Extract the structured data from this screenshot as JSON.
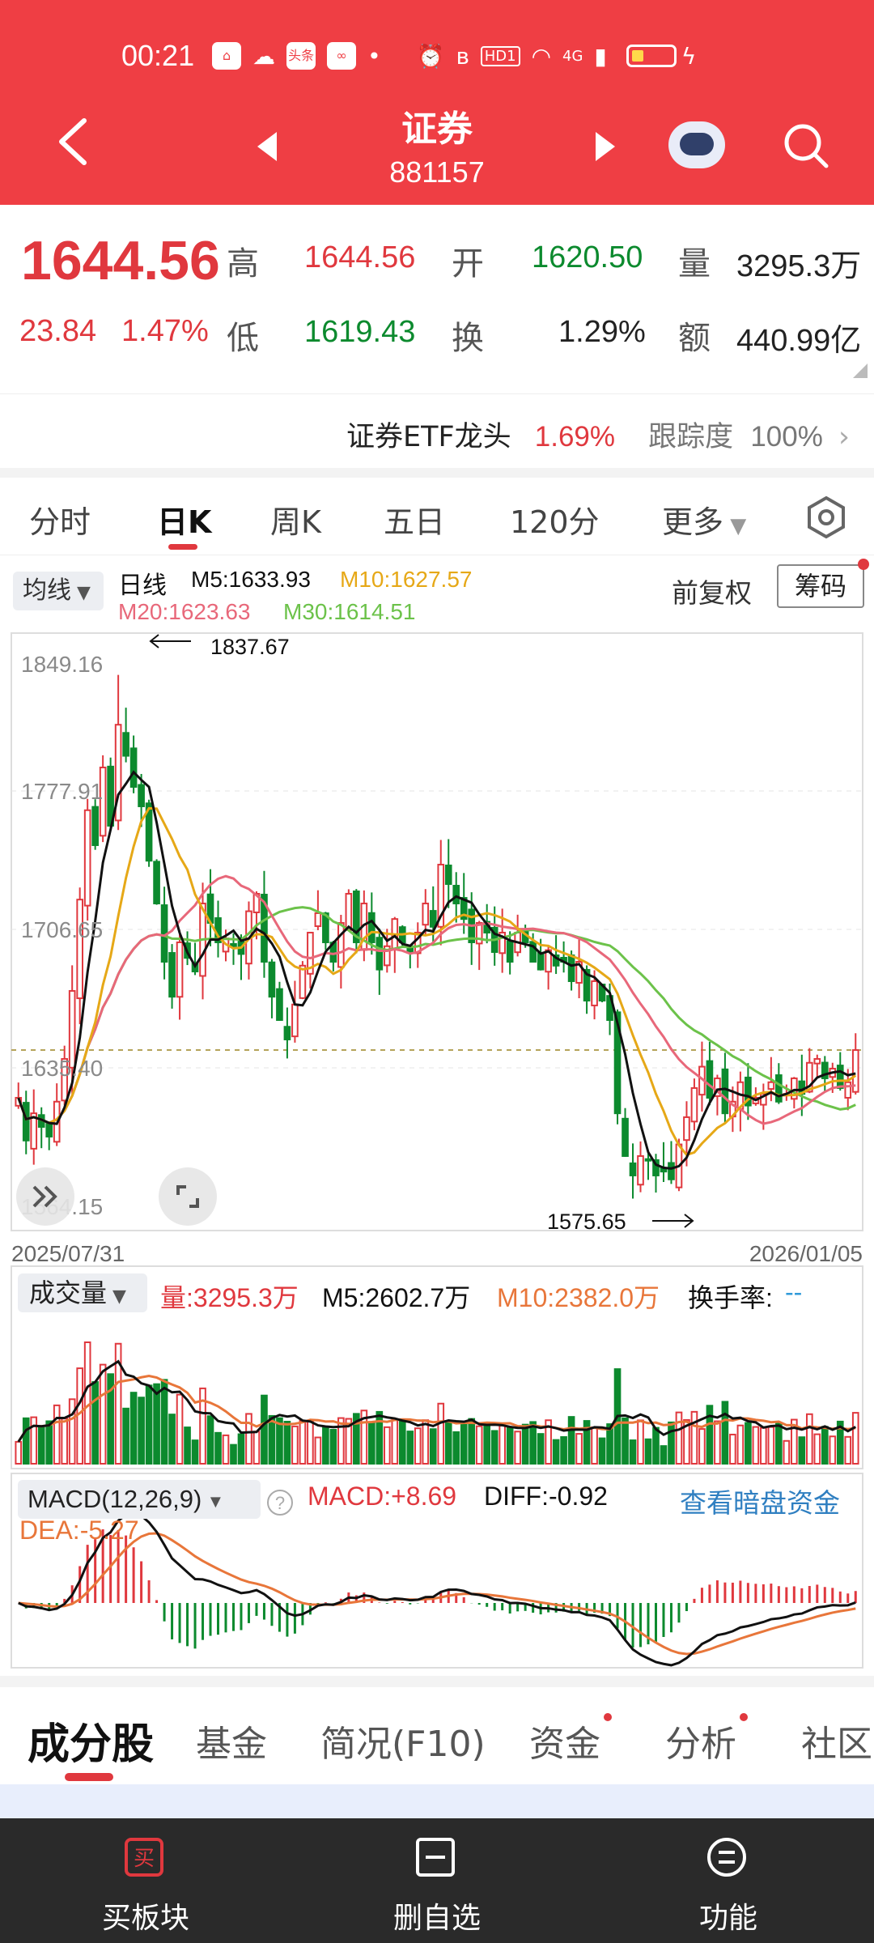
{
  "status_bar": {
    "time": "00:21",
    "icons": [
      "app-icon",
      "app-icon",
      "toutiao-icon",
      "app-icon",
      "dot",
      "alarm-icon",
      "bluetooth-icon",
      "hd-icon",
      "wifi-icon",
      "4g-signal-icon",
      "signal-icon",
      "battery-icon",
      "charging-icon"
    ],
    "hd_label": "HD1",
    "net_label": "4G",
    "toutiao_label": "头条"
  },
  "header": {
    "title": "证券",
    "code": "881157"
  },
  "quote": {
    "price": "1644.56",
    "change": "23.84",
    "change_pct": "1.47%",
    "high_label": "高",
    "high": "1644.56",
    "open_label": "开",
    "open": "1620.50",
    "volume_label": "量",
    "volume": "3295.3万",
    "low_label": "低",
    "low": "1619.43",
    "turnover_label": "换",
    "turnover": "1.29%",
    "amount_label": "额",
    "amount": "440.99亿"
  },
  "etf": {
    "name": "证券ETF龙头",
    "pct": "1.69%",
    "track_label": "跟踪度",
    "track_value": "100%"
  },
  "kline_tabs": [
    "分时",
    "日K",
    "周K",
    "五日",
    "120分",
    "更多"
  ],
  "kline_active": "日K",
  "chart_controls": {
    "ma_select": "均线",
    "line_type": "日线",
    "adjust": "前复权",
    "chip_button": "筹码",
    "ma5": "M5:1633.93",
    "ma10": "M10:1627.57",
    "ma20": "M20:1623.63",
    "ma30": "M30:1614.51"
  },
  "volume_panel": {
    "select": "成交量",
    "vol": "量:3295.3万",
    "m5": "M5:2602.7万",
    "m10": "M10:2382.0万",
    "turnover_label": "换手率:",
    "turnover_value": "--"
  },
  "macd_panel": {
    "select": "MACD(12,26,9)",
    "macd": "MACD:+8.69",
    "diff": "DIFF:-0.92",
    "dea": "DEA:-5.27",
    "link": "查看暗盘资金"
  },
  "colors": {
    "up": "#e0383e",
    "down": "#0c8a2e",
    "ma5": "#111111",
    "ma10": "#e6a817",
    "ma20": "#e8687a",
    "ma30": "#6cc24a",
    "macd_dea": "#e8763a"
  },
  "chart_data": {
    "type": "candlestick",
    "start_date": "2025/07/31",
    "end_date": "2026/01/05",
    "y_ticks": [
      "1849.16",
      "1777.91",
      "1706.65",
      "1635.40",
      "1564.15"
    ],
    "ylim": [
      1564.15,
      1849.16
    ],
    "last_close_ref": 1644.56,
    "annotations": [
      {
        "label": "1837.67",
        "value": 1837.67
      },
      {
        "label": "1575.65",
        "value": 1575.65
      }
    ],
    "closes": [
      1620,
      1598,
      1612,
      1605,
      1600,
      1618,
      1640,
      1675,
      1722,
      1768,
      1750,
      1790,
      1760,
      1812,
      1796,
      1780,
      1770,
      1742,
      1720,
      1690,
      1672,
      1700,
      1692,
      1685,
      1720,
      1710,
      1700,
      1702,
      1698,
      1694,
      1716,
      1725,
      1690,
      1672,
      1660,
      1650,
      1668,
      1688,
      1705,
      1715,
      1700,
      1690,
      1710,
      1725,
      1700,
      1720,
      1700,
      1686,
      1698,
      1712,
      1700,
      1695,
      1705,
      1720,
      1708,
      1740,
      1730,
      1720,
      1712,
      1700,
      1710,
      1705,
      1695,
      1705,
      1690,
      1705,
      1700,
      1690,
      1686,
      1696,
      1688,
      1690,
      1680,
      1690,
      1670,
      1680,
      1670,
      1660,
      1612,
      1590,
      1580,
      1590,
      1588,
      1580,
      1582,
      1578,
      1596,
      1610,
      1625,
      1636,
      1620,
      1630,
      1612,
      1618,
      1628,
      1616,
      1620,
      1622,
      1628,
      1618,
      1622,
      1630,
      1622,
      1638,
      1640,
      1630,
      1635,
      1625,
      1628,
      1644.56
    ]
  }
}
